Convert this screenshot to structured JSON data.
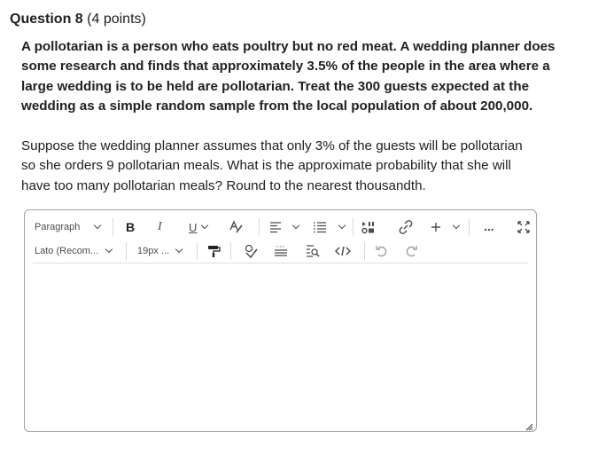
{
  "question": {
    "title": "Question 8",
    "points": "(4 points)"
  },
  "paragraph1": [
    "A pollotarian is a person who eats poultry but no red meat. A wedding planner does",
    "some research and finds that approximately 3.5% of the people in the area where a",
    "large wedding is to be held are pollotarian. Treat the 300 guests expected at the",
    "wedding as a simple random sample from the local population of about 200,000."
  ],
  "paragraph2": [
    "Suppose the wedding planner assumes that only 3% of the guests will be pollotarian",
    "so she orders 9 pollotarian meals. What is the approximate probability that she will",
    "have too many pollotarian meals? Round to the nearest thousandth."
  ],
  "editor": {
    "block_format": "Paragraph",
    "font_family": "Lato (Recom...",
    "font_size": "19px ...",
    "bold_label": "B",
    "italic_label": "I",
    "underline_label": "U",
    "more_label": "...",
    "value": ""
  },
  "icons": {
    "bold": "bold-icon",
    "italic": "italic-icon",
    "underline": "underline-icon",
    "text_color": "text-color-icon",
    "align": "align-icon",
    "list": "list-icon",
    "media": "media-icon",
    "link": "link-icon",
    "insert": "plus-icon",
    "more": "more-icon",
    "fullscreen": "fullscreen-icon",
    "format_painter": "format-painter-icon",
    "spellcheck": "spellcheck-icon",
    "word_count": "word-count-icon",
    "find": "find-replace-icon",
    "source": "source-code-icon",
    "undo": "undo-icon",
    "redo": "redo-icon"
  },
  "colors": {
    "text": "#202122",
    "border": "#9ea1a5",
    "icon": "#494c4e",
    "disabled": "#9ea1a5"
  }
}
